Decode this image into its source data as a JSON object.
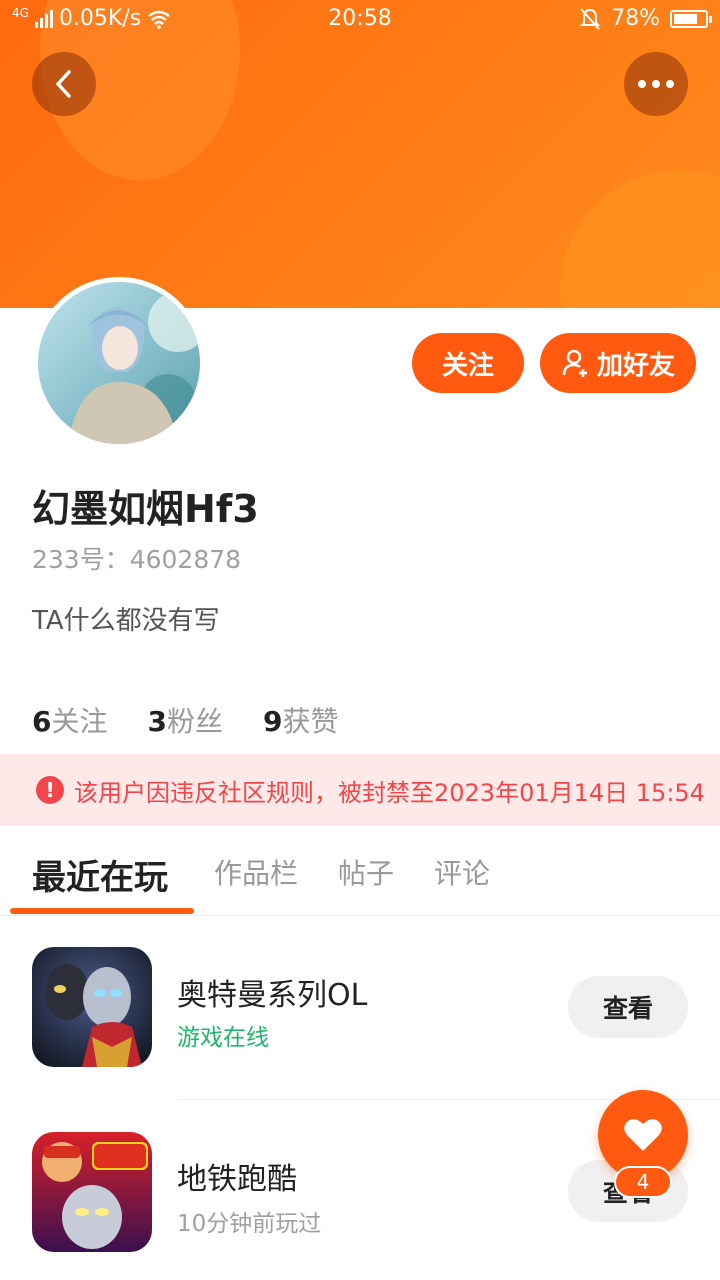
{
  "status_bar": {
    "network": "4G",
    "speed": "0.05K/s",
    "time": "20:58",
    "battery": "78%",
    "battery_level": 0.78
  },
  "header": {
    "back_icon": "chevron-left-icon",
    "more_icon": "more-dots-icon"
  },
  "profile": {
    "username": "幻墨如烟Hf3",
    "uid_text": "233号：4602878",
    "bio": "TA什么都没有写",
    "follow_label": "关注",
    "add_friend_label": "加好友",
    "stats": [
      {
        "num": "6",
        "label": "关注"
      },
      {
        "num": "3",
        "label": "粉丝"
      },
      {
        "num": "9",
        "label": "获赞"
      }
    ]
  },
  "ban_notice": {
    "text": "该用户因违反社区规则，被封禁至2023年01月14日 15:54",
    "color": "#f2474a"
  },
  "tabs": [
    {
      "label": "最近在玩",
      "active": true
    },
    {
      "label": "作品栏",
      "active": false
    },
    {
      "label": "帖子",
      "active": false
    },
    {
      "label": "评论",
      "active": false
    }
  ],
  "games": [
    {
      "name": "奥特曼系列OL",
      "status": "游戏在线",
      "status_color": "#1db86b",
      "button": "查看"
    },
    {
      "name": "地铁跑酷",
      "status": "10分钟前玩过",
      "status_color": "#a0a0a0",
      "button": "查看"
    }
  ],
  "fab": {
    "icon": "heart-icon",
    "badge": "4"
  },
  "colors": {
    "accent": "#ff5a0f",
    "banner": "#ff7a14"
  }
}
